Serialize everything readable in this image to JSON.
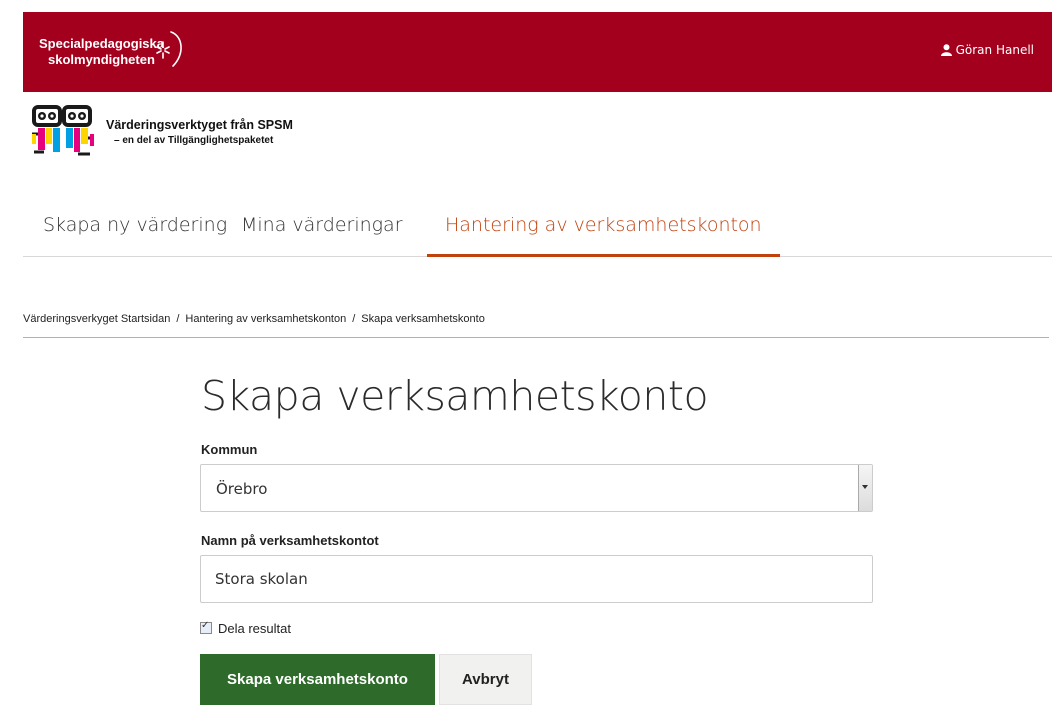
{
  "header": {
    "org_name_line1": "Specialpedagogiska",
    "org_name_line2": "skolmyndigheten",
    "user_name": "Göran Hanell",
    "brand_color": "#a3001e"
  },
  "app": {
    "title": "Värderingsverktyget från SPSM",
    "subtitle": "– en del av Tillgänglighetspaketet"
  },
  "tabs": [
    {
      "label": "Skapa ny värdering",
      "active": false
    },
    {
      "label": "Mina värderingar",
      "active": false
    },
    {
      "label": "Hantering av verksamhetskonton",
      "active": true
    }
  ],
  "breadcrumb": [
    "Värderingsverkyget Startsidan",
    "Hantering av verksamhetskonton",
    "Skapa verksamhetskonto"
  ],
  "form": {
    "title": "Skapa verksamhetskonto",
    "kommun_label": "Kommun",
    "kommun_value": "Örebro",
    "name_label": "Namn på verksamhetskontot",
    "name_value": "Stora skolan",
    "share_label": "Dela resultat",
    "share_checked": true,
    "submit_label": "Skapa verksamhetskonto",
    "cancel_label": "Avbryt",
    "submit_color": "#2e6b2a",
    "accent_color": "#c2420f"
  }
}
